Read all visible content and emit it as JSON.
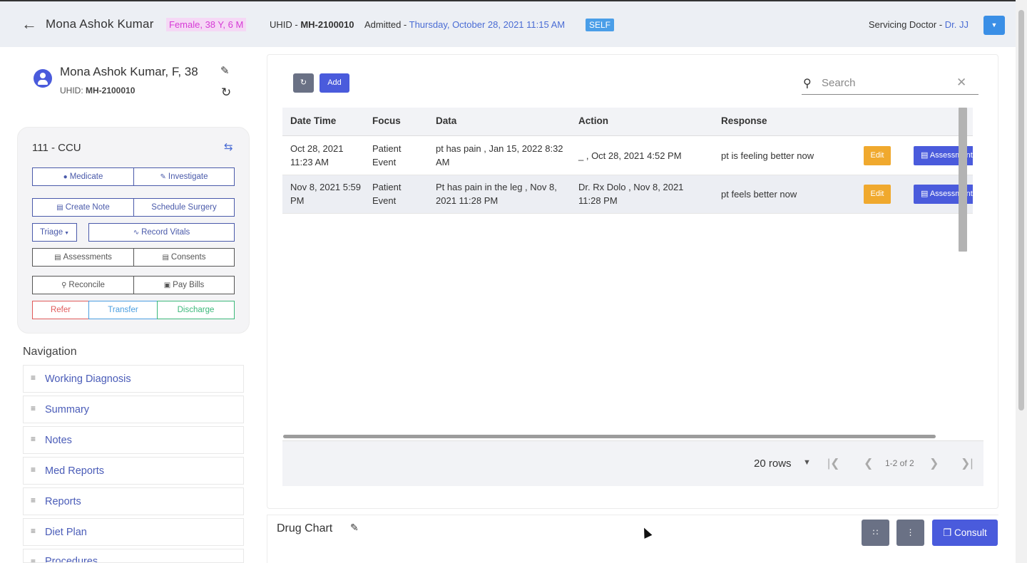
{
  "header": {
    "patient_name": "Mona Ashok Kumar",
    "gender_age": "Female, 38 Y, 6 M",
    "uhid_label": "UHID - ",
    "uhid": "MH-2100010",
    "admitted_label": "Admitted - ",
    "admitted_date": "Thursday, October 28, 2021 11:15 AM",
    "payer_badge": "SELF",
    "servicing_label": "Servicing Doctor - ",
    "servicing_doctor": "Dr. JJ"
  },
  "patient_card": {
    "name": "Mona Ashok Kumar, F, 38",
    "uhid_label": "UHID: ",
    "uhid": "MH-2100010"
  },
  "ward": {
    "title": "111 - CCU",
    "actions": {
      "medicate": "Medicate",
      "investigate": "Investigate",
      "create_note": "Create Note",
      "schedule_surgery": "Schedule Surgery",
      "triage": "Triage",
      "record_vitals": "Record Vitals",
      "assessments": "Assessments",
      "consents": "Consents",
      "reconcile": "Reconcile",
      "pay_bills": "Pay Bills",
      "refer": "Refer",
      "transfer": "Transfer",
      "discharge": "Discharge"
    }
  },
  "navigation": {
    "heading": "Navigation",
    "items": [
      "Working Diagnosis",
      "Summary",
      "Notes",
      "Med Reports",
      "Reports",
      "Diet Plan",
      "Procedures"
    ]
  },
  "toolbar": {
    "add_label": "Add",
    "search_placeholder": "Search"
  },
  "table": {
    "columns": [
      "Date Time",
      "Focus",
      "Data",
      "Action",
      "Response"
    ],
    "rows": [
      {
        "date_time": "Oct 28, 2021 11:23 AM",
        "focus": "Patient Event",
        "data": "pt has pain , Jan 15, 2022 8:32 AM",
        "action": "_ , Oct 28, 2021 4:52 PM",
        "response": "pt is feeling better now",
        "edit_label": "Edit",
        "assess_label": "Assessments"
      },
      {
        "date_time": "Nov 8, 2021 5:59 PM",
        "focus": "Patient Event",
        "data": "Pt has pain in the leg , Nov 8, 2021 11:28 PM",
        "action": "Dr. Rx Dolo , Nov 8, 2021 11:28 PM",
        "response": "pt feels better now",
        "edit_label": "Edit",
        "assess_label": "Assessments"
      }
    ]
  },
  "pagination": {
    "rows_per_page": "20 rows",
    "range": "1-2 of 2"
  },
  "drug_chart": {
    "title": "Drug Chart"
  },
  "footer_buttons": {
    "consult": "Consult"
  },
  "colors": {
    "primary": "#4a5bdc",
    "edit": "#f0a92e",
    "gender_badge": "#d63bd6",
    "self_badge": "#4a9ee8",
    "refer": "#e05a5a",
    "transfer": "#4a9ee0",
    "discharge": "#3cb87a"
  }
}
